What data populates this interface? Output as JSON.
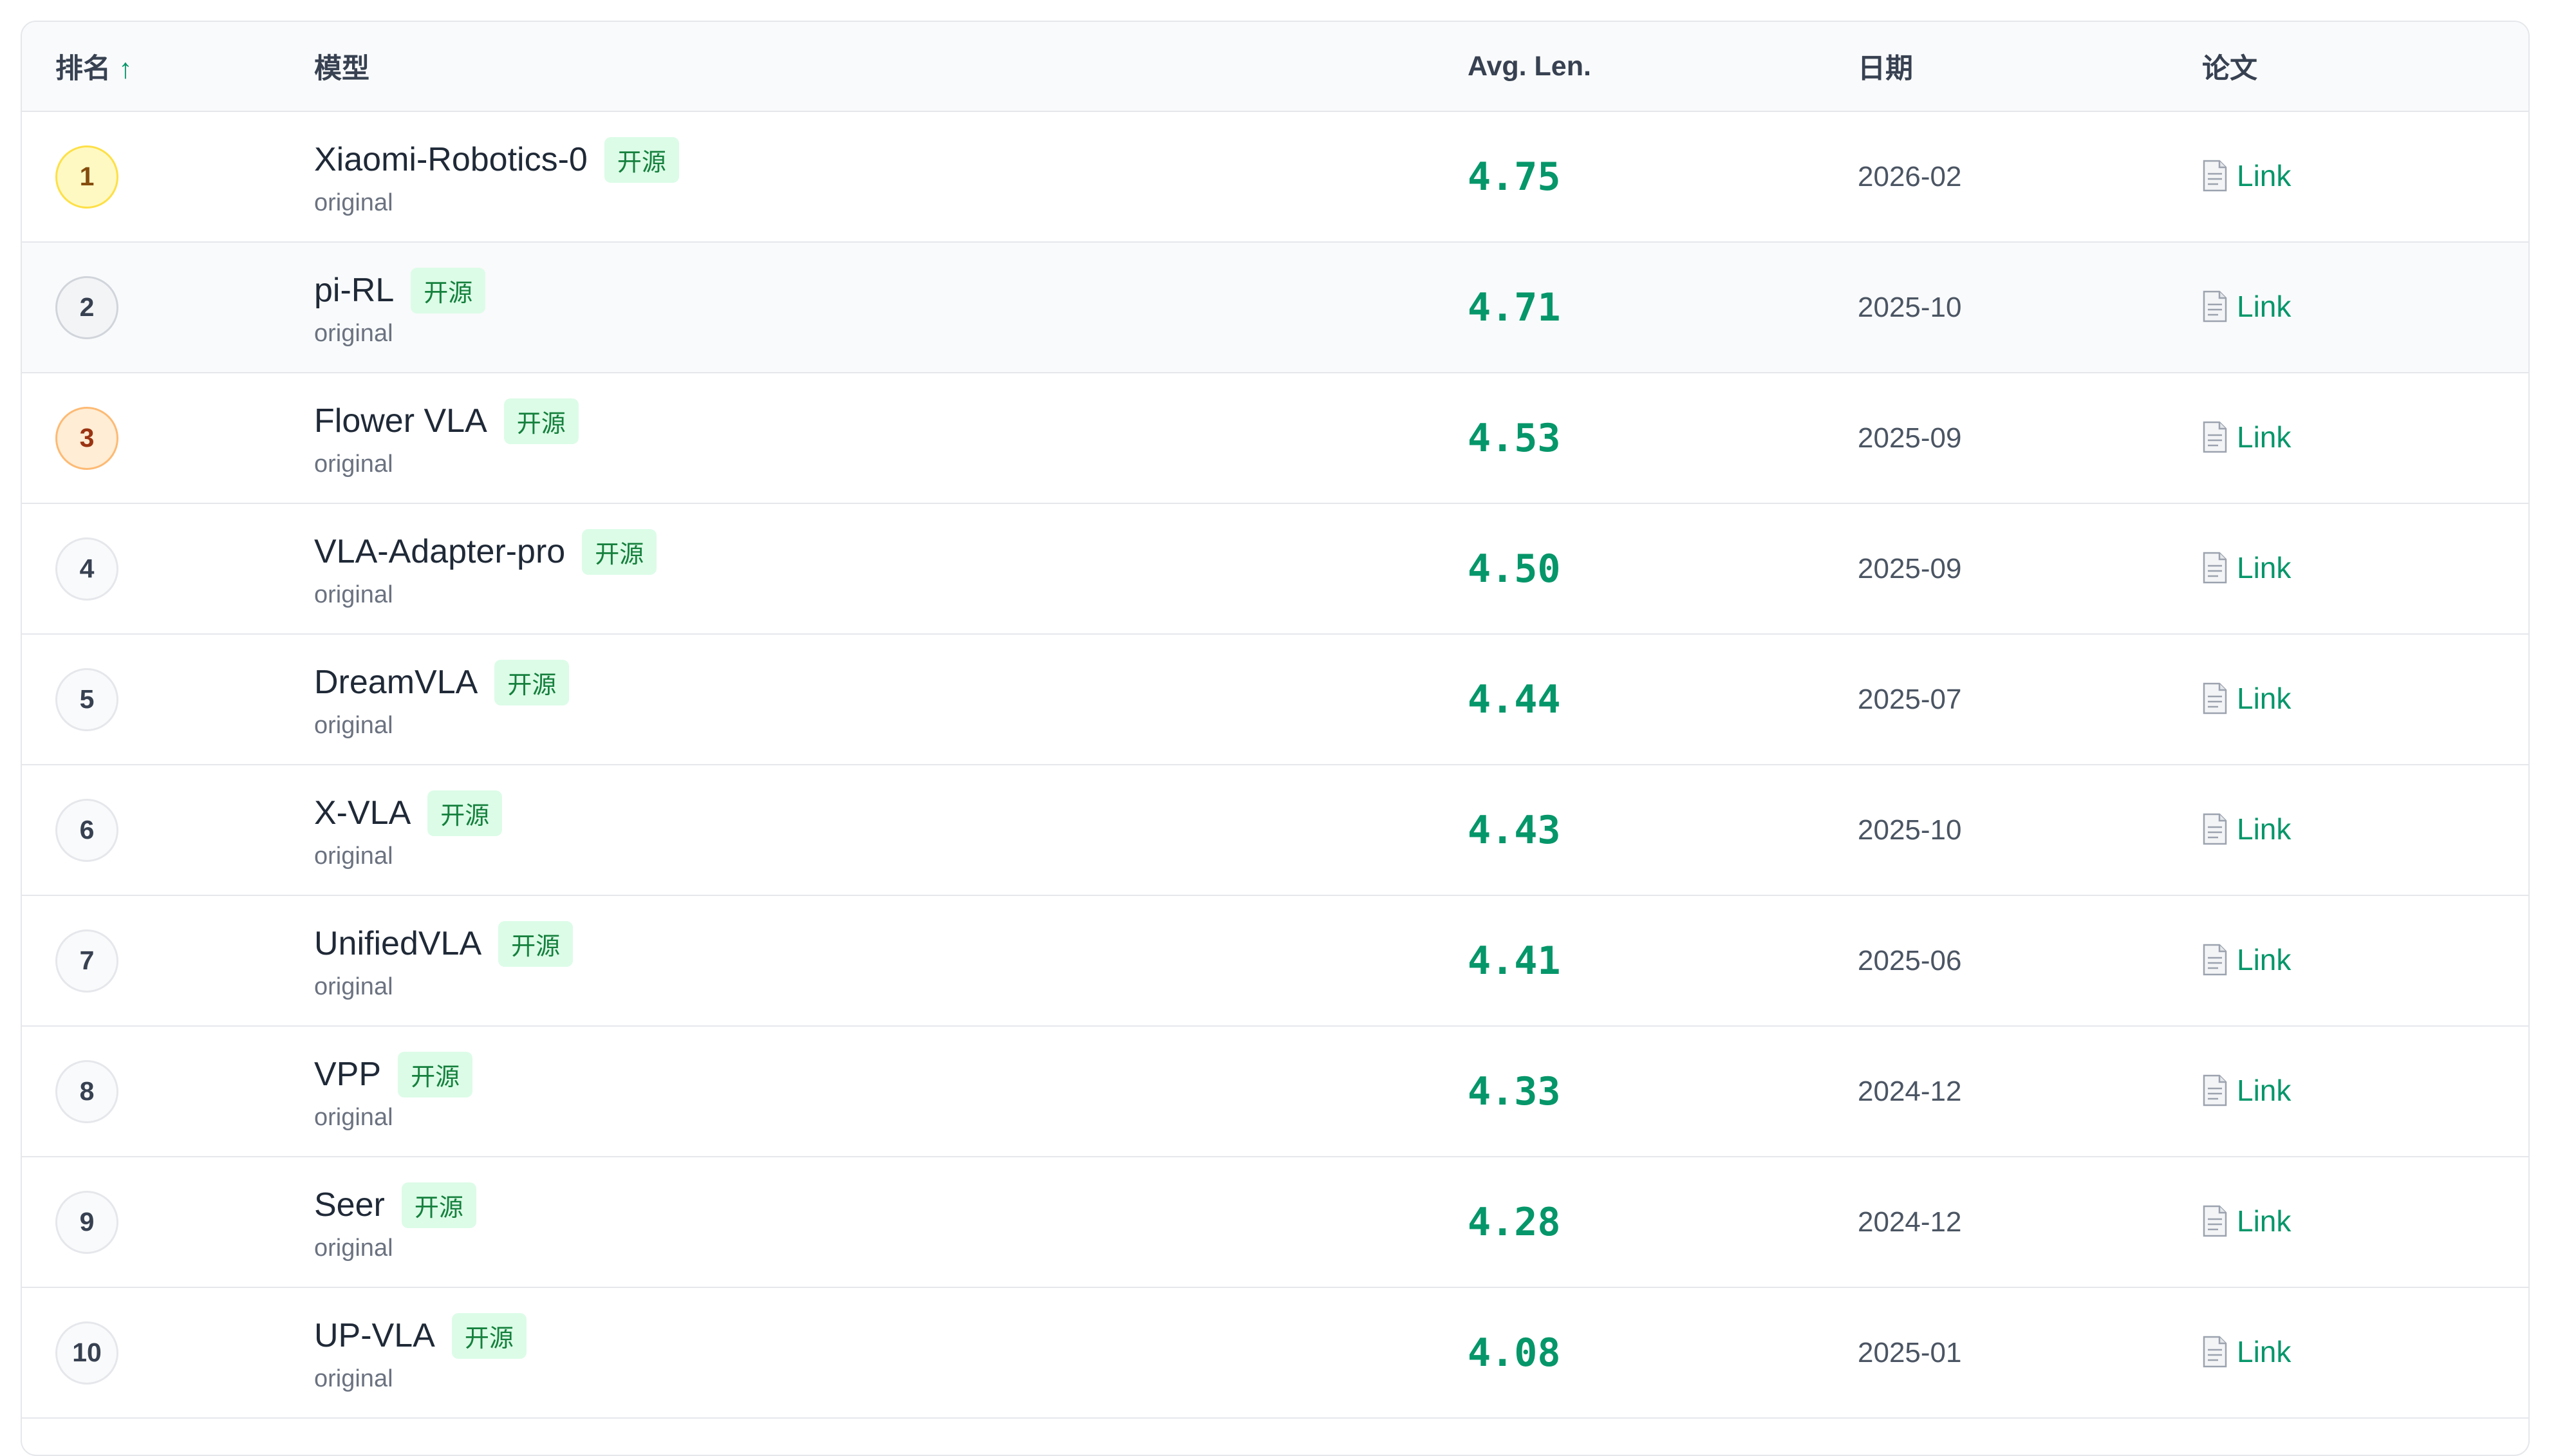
{
  "header": {
    "rank": "排名",
    "rank_sort_arrow": "↑",
    "model": "模型",
    "avg_len": "Avg. Len.",
    "date": "日期",
    "paper": "论文"
  },
  "rows": [
    {
      "rank": "1",
      "model": "Xiaomi-Robotics-0",
      "tag": "开源",
      "sub": "original",
      "avg_len": "4.75",
      "date": "2026-02",
      "link": "Link"
    },
    {
      "rank": "2",
      "model": "pi-RL",
      "tag": "开源",
      "sub": "original",
      "avg_len": "4.71",
      "date": "2025-10",
      "link": "Link"
    },
    {
      "rank": "3",
      "model": "Flower VLA",
      "tag": "开源",
      "sub": "original",
      "avg_len": "4.53",
      "date": "2025-09",
      "link": "Link"
    },
    {
      "rank": "4",
      "model": "VLA-Adapter-pro",
      "tag": "开源",
      "sub": "original",
      "avg_len": "4.50",
      "date": "2025-09",
      "link": "Link"
    },
    {
      "rank": "5",
      "model": "DreamVLA",
      "tag": "开源",
      "sub": "original",
      "avg_len": "4.44",
      "date": "2025-07",
      "link": "Link"
    },
    {
      "rank": "6",
      "model": "X-VLA",
      "tag": "开源",
      "sub": "original",
      "avg_len": "4.43",
      "date": "2025-10",
      "link": "Link"
    },
    {
      "rank": "7",
      "model": "UnifiedVLA",
      "tag": "开源",
      "sub": "original",
      "avg_len": "4.41",
      "date": "2025-06",
      "link": "Link"
    },
    {
      "rank": "8",
      "model": "VPP",
      "tag": "开源",
      "sub": "original",
      "avg_len": "4.33",
      "date": "2024-12",
      "link": "Link"
    },
    {
      "rank": "9",
      "model": "Seer",
      "tag": "开源",
      "sub": "original",
      "avg_len": "4.28",
      "date": "2024-12",
      "link": "Link"
    },
    {
      "rank": "10",
      "model": "UP-VLA",
      "tag": "开源",
      "sub": "original",
      "avg_len": "4.08",
      "date": "2025-01",
      "link": "Link"
    }
  ],
  "icons": {
    "paper_link": "document-icon"
  },
  "colors": {
    "accent": "#059669",
    "tag_bg": "#dcfce7",
    "tag_text": "#15803d",
    "gold_bg": "#fef9c3",
    "silver_bg": "#f3f4f6",
    "bronze_bg": "#ffedd5"
  }
}
